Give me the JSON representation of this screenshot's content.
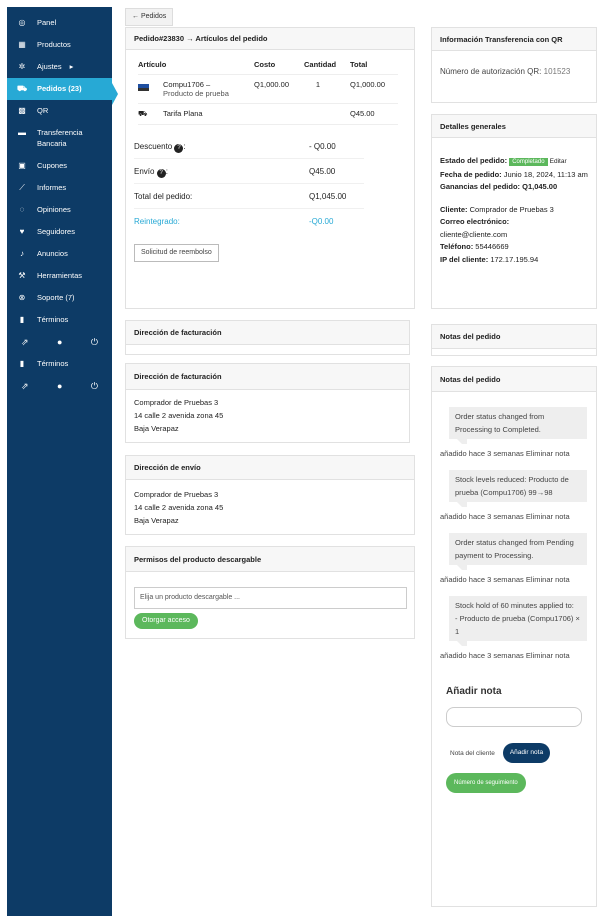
{
  "sidebar": {
    "items": [
      {
        "icon": "dashboard-icon",
        "glyph": "◎",
        "label": "Panel"
      },
      {
        "icon": "briefcase-icon",
        "glyph": "▦",
        "label": "Productos"
      },
      {
        "icon": "gear-icon",
        "glyph": "✲",
        "label": "Ajustes",
        "caret": "▸"
      },
      {
        "icon": "cart-icon",
        "glyph": "⛟",
        "label": "Pedidos (23)",
        "active": true
      },
      {
        "icon": "qr-icon",
        "glyph": "▩",
        "label": "QR"
      },
      {
        "icon": "card-icon",
        "glyph": "▬",
        "label": "Transferencia Bancaria"
      },
      {
        "icon": "gift-icon",
        "glyph": "▣",
        "label": "Cupones"
      },
      {
        "icon": "chart-icon",
        "glyph": "⟋",
        "label": "Informes"
      },
      {
        "icon": "comments-icon",
        "glyph": "◌",
        "label": "Opiniones"
      },
      {
        "icon": "heart-icon",
        "glyph": "♥",
        "label": "Seguidores"
      },
      {
        "icon": "bell-icon",
        "glyph": "♪",
        "label": "Anuncios"
      },
      {
        "icon": "wrench-icon",
        "glyph": "⚒",
        "label": "Herramientas"
      },
      {
        "icon": "lifebuoy-icon",
        "glyph": "⊗",
        "label": "Soporte (7)"
      },
      {
        "icon": "page-icon",
        "glyph": "▮",
        "label": "Términos"
      }
    ],
    "icon_row_1": {
      "external": "⇗",
      "user": "●",
      "power": "⏻"
    },
    "terms2": {
      "icon": "page-icon",
      "glyph": "▮",
      "label": "Términos"
    },
    "icon_row_2": {
      "external": "⇗",
      "user": "●",
      "power": "⏻"
    }
  },
  "back_button": "← Pedidos",
  "order": {
    "title": "Pedido#23830 → Artículos del pedido",
    "columns": [
      "Artículo",
      "Costo",
      "Cantidad",
      "Total"
    ],
    "item": {
      "name": "Compu1706 –",
      "subtitle": "Producto de prueba",
      "cost": "Q1,000.00",
      "qty": "1",
      "total": "Q1,000.00"
    },
    "shipping": {
      "name": "Tarifa Plana",
      "total": "Q45.00"
    },
    "totals": [
      {
        "label": "Descuento",
        "help": "?",
        "colon": ":",
        "value": "- Q0.00"
      },
      {
        "label": "Envío",
        "help": "?",
        "colon": ":",
        "value": "Q45.00"
      },
      {
        "label": "Total del pedido:",
        "value": "Q1,045.00"
      },
      {
        "label": "Reintegrado:",
        "value": "-Q0.00"
      }
    ],
    "refund_button": "Solicitud de reembolso"
  },
  "billing_empty_title": "Dirección de facturación",
  "billing": {
    "title": "Dirección de facturación",
    "lines": [
      "Comprador de Pruebas 3",
      "14 calle 2 avenida zona 45",
      "Baja Verapaz"
    ]
  },
  "shipping_addr": {
    "title": "Dirección de envío",
    "lines": [
      "Comprador de Pruebas 3",
      "14 calle 2 avenida zona 45",
      "Baja Verapaz"
    ]
  },
  "downloads": {
    "title": "Permisos del producto descargable",
    "placeholder": "Elija un producto descargable ...",
    "button": "Otorgar acceso"
  },
  "qr": {
    "title": "Información Transferencia con QR",
    "label": "Número de autorización QR:",
    "value": "101523"
  },
  "general": {
    "title": "Detalles generales",
    "status_label": "Estado del pedido:",
    "status_value": "Completado",
    "edit": "Editar",
    "date_label": "Fecha de pedido:",
    "date_value": "Junio 18, 2024, 11:13 am",
    "earnings_label": "Ganancias del pedido:",
    "earnings_value": "Q1,045.00",
    "client_label": "Cliente:",
    "client_value": "Comprador de Pruebas 3",
    "email_label": "Correo electrónico:",
    "email_value": "cliente@cliente.com",
    "phone_label": "Teléfono:",
    "phone_value": "55446669",
    "ip_label": "IP del cliente:",
    "ip_value": "172.17.195.94"
  },
  "notes_small_title": "Notas del pedido",
  "notes": {
    "title": "Notas del pedido",
    "items": [
      {
        "text": "Order status changed from Processing to Completed.",
        "meta": "añadido hace 3 semanas Eliminar nota"
      },
      {
        "text": "Stock levels reduced: Producto de prueba (Compu1706) 99→98",
        "meta": "añadido hace 3 semanas Eliminar nota"
      },
      {
        "text": "Order status changed from Pending payment to Processing.",
        "meta": "añadido hace 3 semanas Eliminar nota"
      },
      {
        "text": "Stock hold of 60 minutes applied to:\n- Producto de prueba (Compu1706) × 1",
        "meta": "añadido hace 3 semanas Eliminar nota"
      }
    ],
    "add_title": "Añadir nota",
    "type_option": "Nota del cliente",
    "add_button": "Añadir nota",
    "tracking_button": "Número de seguimiento"
  }
}
